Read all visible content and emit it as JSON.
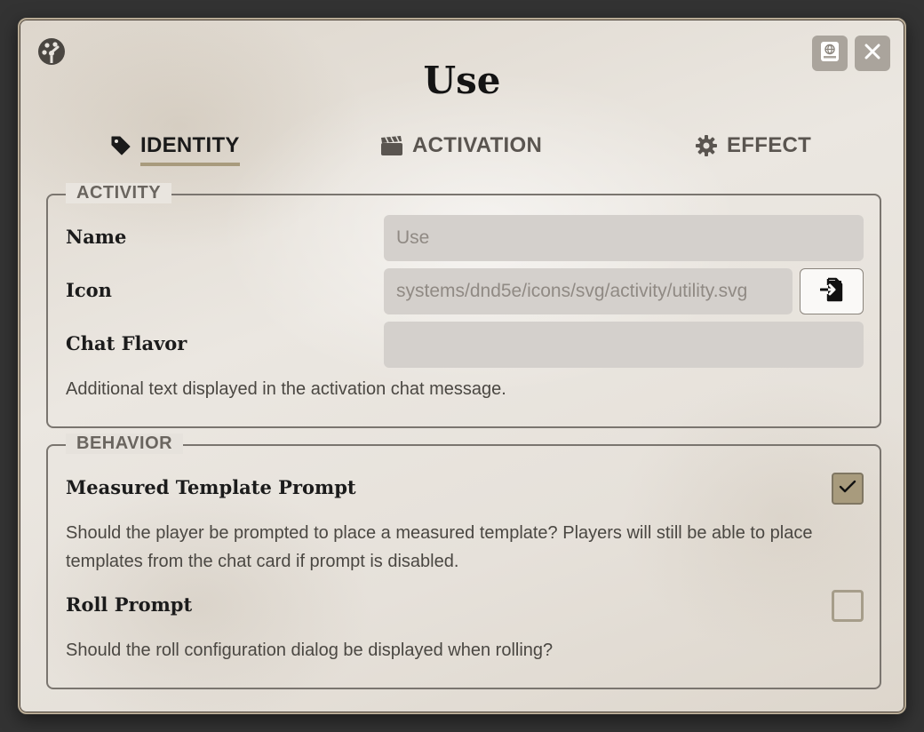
{
  "window": {
    "title": "Use",
    "logo_icon": "d20-dial-icon",
    "sheet_button_icon": "globe-sheet-icon",
    "close_button_icon": "close-icon"
  },
  "tabs": [
    {
      "label": "IDENTITY",
      "icon": "tag-icon",
      "active": true
    },
    {
      "label": "ACTIVATION",
      "icon": "clapperboard-icon",
      "active": false
    },
    {
      "label": "EFFECT",
      "icon": "gear-icon",
      "active": false
    }
  ],
  "activity": {
    "legend": "ACTIVITY",
    "name_label": "Name",
    "name_placeholder": "Use",
    "icon_label": "Icon",
    "icon_value": "systems/dnd5e/icons/svg/activity/utility.svg",
    "file_picker_icon": "file-import-icon",
    "chat_flavor_label": "Chat Flavor",
    "chat_flavor_value": "",
    "chat_flavor_hint": "Additional text displayed in the activation chat message."
  },
  "behavior": {
    "legend": "BEHAVIOR",
    "template_prompt_label": "Measured Template Prompt",
    "template_prompt_checked": true,
    "template_prompt_hint": "Should the player be prompted to place a measured template? Players will still be able to place templates from the chat card if prompt is disabled.",
    "roll_prompt_label": "Roll Prompt",
    "roll_prompt_checked": false,
    "roll_prompt_hint": "Should the roll configuration dialog be displayed when rolling?"
  },
  "colors": {
    "accent": "#a89b7d",
    "background": "#333333",
    "input_bg": "#d4d0cc"
  }
}
